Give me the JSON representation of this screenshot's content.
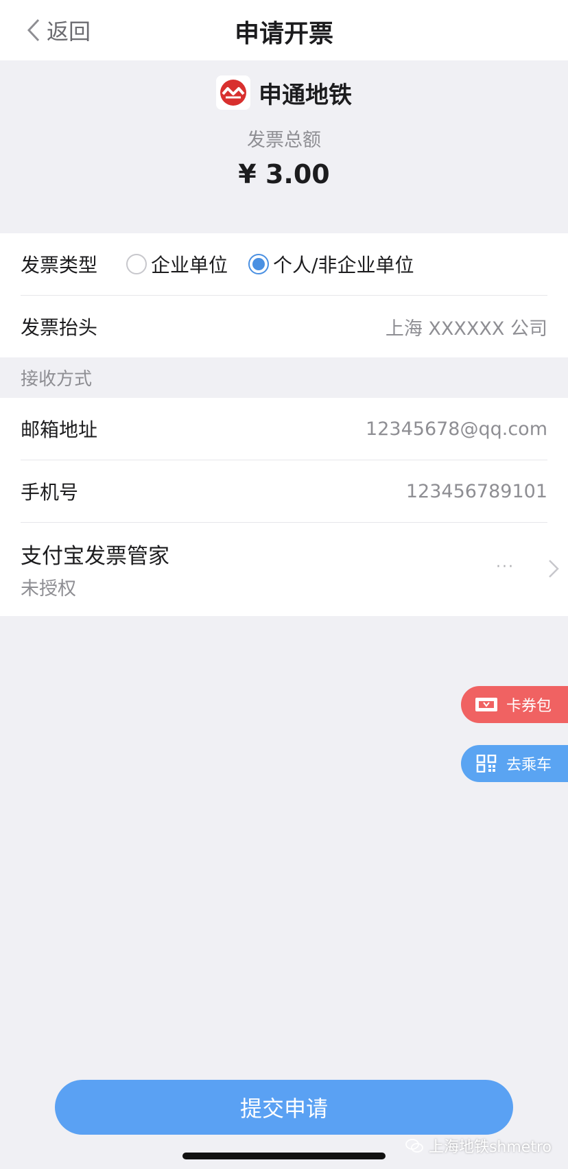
{
  "nav": {
    "back_label": "返回",
    "title": "申请开票"
  },
  "summary": {
    "brand_name": "申通地铁",
    "total_label": "发票总额",
    "total_amount": "¥ 3.00"
  },
  "invoice_type": {
    "label": "发票类型",
    "options": [
      {
        "label": "企业单位",
        "selected": false
      },
      {
        "label": "个人/非企业单位",
        "selected": true
      }
    ]
  },
  "invoice_title": {
    "label": "发票抬头",
    "value": "上海 XXXXXX 公司"
  },
  "receive_section": {
    "header": "接收方式"
  },
  "email": {
    "label": "邮箱地址",
    "value": "12345678@qq.com"
  },
  "phone": {
    "label": "手机号",
    "value": "123456789101"
  },
  "alipay": {
    "title": "支付宝发票管家",
    "status": "未授权",
    "more": "···"
  },
  "floating": {
    "wallet_label": "卡券包",
    "ride_label": "去乘车"
  },
  "submit_label": "提交申请",
  "watermark": "上海地铁shmetro",
  "colors": {
    "accent": "#5aa1f3",
    "radio_selected": "#4a90e2",
    "wallet_button": "#f06262",
    "ride_button": "#5aa4f2",
    "brand_red": "#d8302e"
  }
}
